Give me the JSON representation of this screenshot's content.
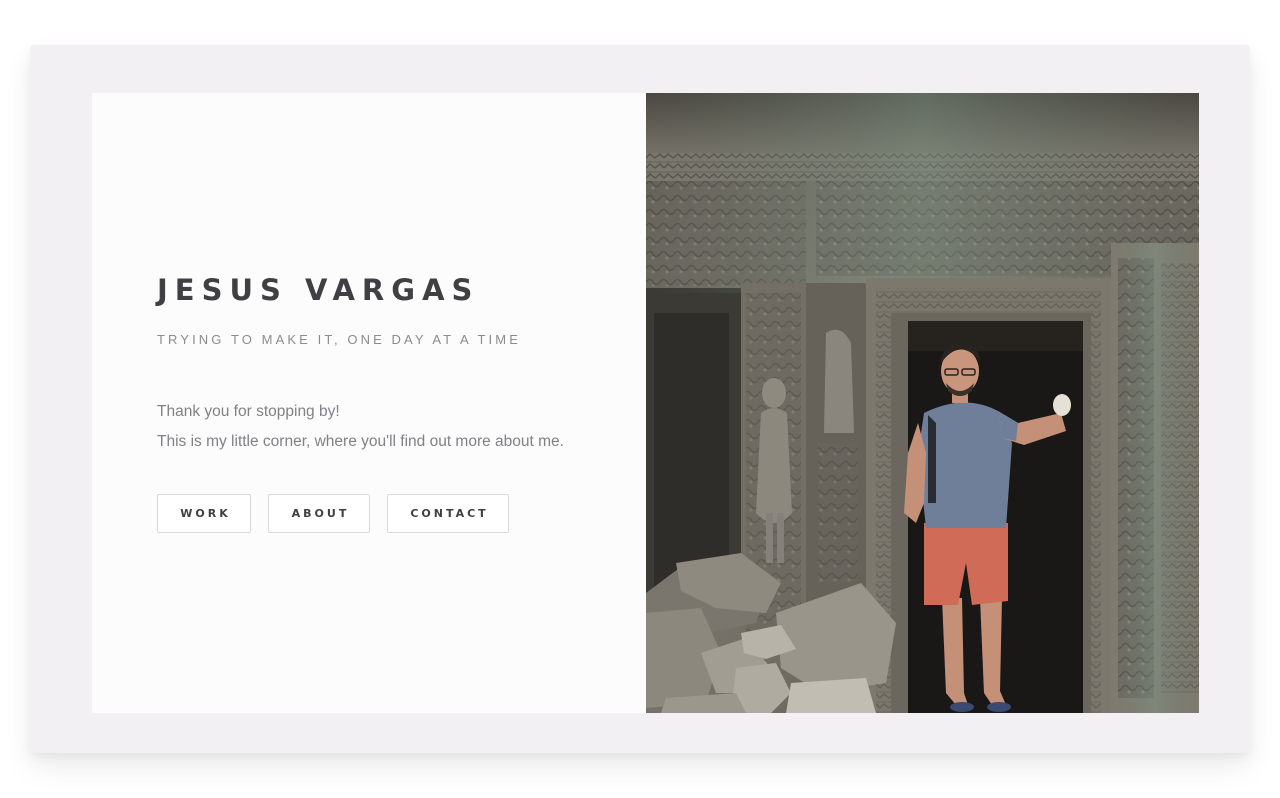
{
  "profile": {
    "name": "JESUS VARGAS",
    "tagline": "TRYING TO MAKE IT, ONE DAY AT A TIME",
    "intro_line_1": "Thank you for stopping by!",
    "intro_line_2": "This is my little corner, where you'll find out more about me."
  },
  "nav": {
    "work_label": "WORK",
    "about_label": "ABOUT",
    "contact_label": "CONTACT"
  },
  "photo": {
    "subject": "man-standing-in-temple-doorway"
  },
  "colors": {
    "frame_bg": "#f2f0f3",
    "card_bg": "#fdfcfc",
    "heading": "#403f43",
    "muted_text": "#8b8b90",
    "button_border": "#d9d8db"
  }
}
